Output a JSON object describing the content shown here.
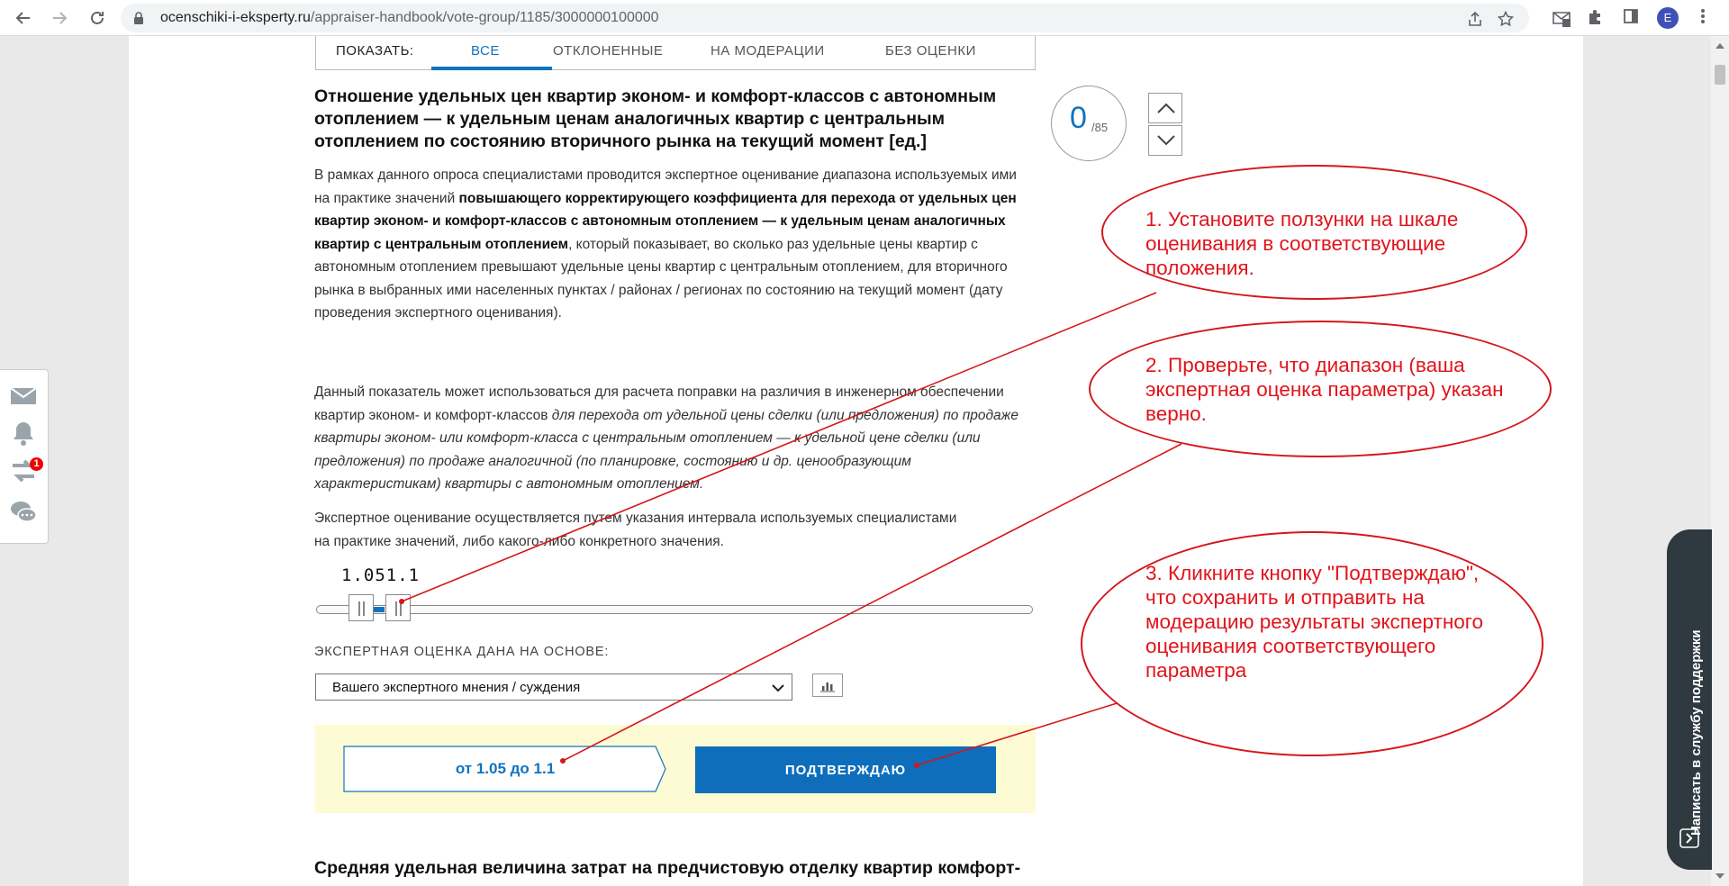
{
  "browser": {
    "url_domain": "ocenschiki-i-eksperty.ru",
    "url_path": "/appraiser-handbook/vote-group/1185/3000000100000",
    "profile_initial": "E"
  },
  "filter": {
    "label": "ПОКАЗАТЬ:",
    "tabs": [
      {
        "label": "ВСЕ"
      },
      {
        "label": "ОТКЛОНЕННЫЕ"
      },
      {
        "label": "НА МОДЕРАЦИИ"
      },
      {
        "label": "БЕЗ ОЦЕНКИ"
      }
    ]
  },
  "question": {
    "title": "Отношение удельных цен квартир эконом- и комфорт-классов с автономным отоплением — к удельным ценам аналогичных квартир с центральным отоплением по состоянию вторичного рынка на текущий момент [ед.]",
    "p1_a": "В рамках данного опроса специалистами проводится экспертное оценивание диапазона используемых ими на практике значений ",
    "p1_bold": "повышающего корректирующего коэффициента для перехода от удельных цен квартир эконом- и комфорт-классов с автономным отоплением — к удельным ценам аналогичных квартир с центральным отоплением",
    "p1_b": ", который показывает, во сколько раз удельные цены квартир с автономным отоплением превышают удельные цены квартир с центральным отоплением, для вторичного рынка в выбранных ими населенных пунктах / районах / регионах по состоянию на текущий момент (дату проведения экспертного оценивания).",
    "p2_a": "Данный показатель может использоваться для расчета поправки на различия в инженерном обеспечении квартир эконом- и комфорт-классов ",
    "p2_italic": "для перехода от удельной цены сделки (или предложения) по продаже квартиры эконом- или комфорт-класса с центральным отоплением — к удельной цене сделки (или предложения) по продаже аналогичной (по планировке, состоянию и др. ценообразующим характеристикам) квартиры с автономным отоплением.",
    "p3": "Экспертное оценивание осуществляется путем указания интервала используемых специалистами на практике значений, либо какого-либо конкретного значения."
  },
  "counter": {
    "value": "0",
    "total": "/85"
  },
  "slider": {
    "value_text": "1.051.1",
    "low": 1.05,
    "high": 1.1
  },
  "basis": {
    "label": "ЭКСПЕРТНАЯ ОЦЕНКА ДАНА НА ОСНОВЕ:",
    "selected": "Вашего экспертного мнения / суждения"
  },
  "confirm": {
    "range_text": "от 1.05 до 1.1",
    "button_label": "ПОДТВЕРЖДАЮ"
  },
  "next_question": {
    "title": "Средняя удельная величина затрат на предчистовую отделку квартир комфорт-"
  },
  "left_toolbar": {
    "badge": "1"
  },
  "support": {
    "label": "Написать в службу поддержки"
  },
  "annotations": {
    "step1": "1. Установите ползунки на шкале оценивания в соответствующие положения.",
    "step2": "2. Проверьте, что диапазон (ваша экспертная оценка параметра) указан верно.",
    "step3": "3. Кликните кнопку \"Подтверждаю\", что сохранить и отправить на модерацию результаты экспертного оценивания соответствующего параметра"
  },
  "colors": {
    "accent": "#1173bf",
    "annotation": "#e0141b",
    "confirm_bg": "#fdfbd3"
  }
}
